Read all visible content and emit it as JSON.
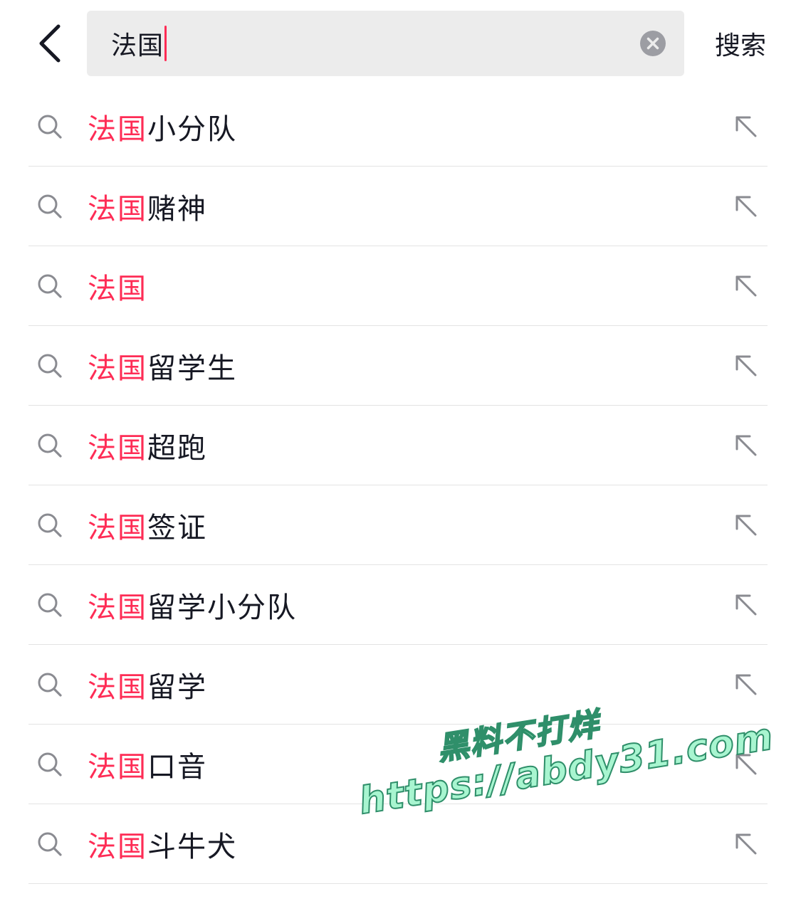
{
  "colors": {
    "accent": "#fe2c55",
    "text": "#161823",
    "icon": "#8a8b91",
    "search_bg": "#ececec",
    "divider": "#e3e3e3",
    "watermark_fill": "#9ef0c4",
    "watermark_stroke": "#2f8f6a"
  },
  "header": {
    "back_icon": "chevron-left-icon",
    "search": {
      "value": "法国",
      "clear_icon": "clear-circle-icon"
    },
    "search_label": "搜索"
  },
  "suggestions": {
    "search_icon": "search-icon",
    "fill_icon": "arrow-up-left-icon",
    "items": [
      {
        "highlight": "法国",
        "rest": "小分队"
      },
      {
        "highlight": "法国",
        "rest": "赌神"
      },
      {
        "highlight": "法国",
        "rest": ""
      },
      {
        "highlight": "法国",
        "rest": "留学生"
      },
      {
        "highlight": "法国",
        "rest": "超跑"
      },
      {
        "highlight": "法国",
        "rest": "签证"
      },
      {
        "highlight": "法国",
        "rest": "留学小分队"
      },
      {
        "highlight": "法国",
        "rest": "留学"
      },
      {
        "highlight": "法国",
        "rest": "口音"
      },
      {
        "highlight": "法国",
        "rest": "斗牛犬"
      }
    ]
  },
  "watermark": {
    "line1": "黑料不打烊",
    "line2": "https://abdy31.com"
  }
}
